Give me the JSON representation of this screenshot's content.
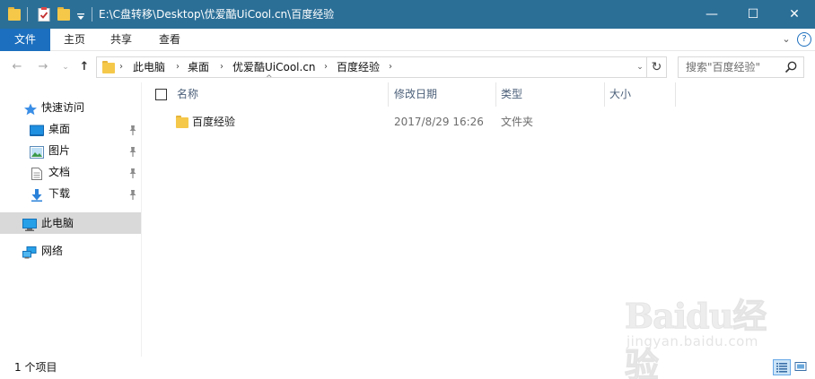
{
  "titlebar": {
    "path": "E:\\C盘转移\\Desktop\\优爱酷UiCool.cn\\百度经验",
    "quick_access_icons": [
      "folder-icon",
      "properties-icon",
      "new-folder-icon",
      "customize-dropdown-icon"
    ],
    "controls": {
      "minimize": "—",
      "maximize": "☐",
      "close": "✕"
    },
    "background": "#2b6f97"
  },
  "ribbon": {
    "tabs": [
      {
        "label": "文件",
        "active": true
      },
      {
        "label": "主页"
      },
      {
        "label": "共享"
      },
      {
        "label": "查看"
      }
    ],
    "expand_glyph": "⌄",
    "help_glyph": "?",
    "accent": "#1c6fbe"
  },
  "nav": {
    "back": "←",
    "forward": "→",
    "recent_dropdown": "⌄",
    "up": "↑"
  },
  "address": {
    "breadcrumbs": [
      "此电脑",
      "桌面",
      "优爱酷UiCool.cn",
      "百度经验"
    ],
    "separator": "›",
    "dropdown_glyph": "⌄",
    "refresh_glyph": "↻"
  },
  "search": {
    "placeholder": "搜索\"百度经验\""
  },
  "sidebar": {
    "quick_access": {
      "label": "快速访问",
      "icon": "star-icon"
    },
    "pinned": [
      {
        "label": "桌面",
        "icon": "desktop-icon",
        "pinned": true
      },
      {
        "label": "图片",
        "icon": "pictures-icon",
        "pinned": true
      },
      {
        "label": "文档",
        "icon": "documents-icon",
        "pinned": true
      },
      {
        "label": "下载",
        "icon": "downloads-icon",
        "pinned": true
      }
    ],
    "this_pc": {
      "label": "此电脑",
      "icon": "computer-icon",
      "selected": true
    },
    "network": {
      "label": "网络",
      "icon": "network-icon"
    },
    "selected_color": "#d9d9d9"
  },
  "file_list": {
    "columns": [
      "名称",
      "修改日期",
      "类型",
      "大小"
    ],
    "sort_glyph": "^",
    "rows": [
      {
        "name": "百度经验",
        "modified": "2017/8/29 16:26",
        "type": "文件夹",
        "size": ""
      }
    ],
    "header_color": "#4c607a"
  },
  "statusbar": {
    "text": "1 个项目",
    "views": [
      "details-view-icon",
      "large-icons-view-icon"
    ],
    "active_view": "details-view-icon"
  },
  "watermark": {
    "brand": "Baidu经验",
    "url": "jingyan.baidu.com"
  }
}
